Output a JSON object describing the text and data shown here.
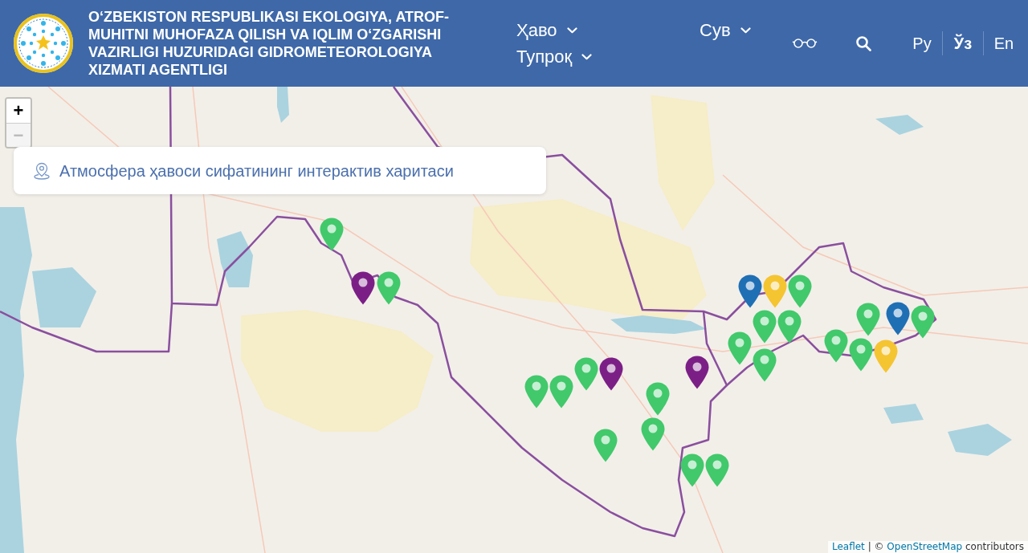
{
  "header": {
    "agency_name": "O‘ZBEKISTON RESPUBLIKASI EKOLOGIYA, ATROF-MUHITNI MUHOFAZA QILISH VA IQLIM O‘ZGARISHI VAZIRLIGI HUZURIDAGI GIDROMETEOROLOGIYA XIZMATI AGENTLIGI"
  },
  "nav": [
    {
      "label": "Ҳаво"
    },
    {
      "label": "Тупроқ"
    },
    {
      "label": "Сув"
    }
  ],
  "languages": [
    {
      "label": "Ру",
      "selected": false
    },
    {
      "label": "Ўз",
      "selected": true
    },
    {
      "label": "En",
      "selected": false
    }
  ],
  "map": {
    "zoom_controls": [
      {
        "label": "+",
        "disabled": false
      },
      {
        "label": "−",
        "disabled": true
      }
    ],
    "title": "Атмосфера ҳавоси сифатининг интерактив харитаси",
    "markers": [
      {
        "color": "#41c96b"
      },
      {
        "color": "#7b1f86"
      },
      {
        "color": "#41c96b"
      },
      {
        "color": "#41c96b"
      },
      {
        "color": "#41c96b"
      },
      {
        "color": "#41c96b"
      },
      {
        "color": "#7b1f86"
      },
      {
        "color": "#7b1f86"
      },
      {
        "color": "#41c96b"
      },
      {
        "color": "#41c96b"
      },
      {
        "color": "#41c96b"
      },
      {
        "color": "#41c96b"
      },
      {
        "color": "#41c96b"
      },
      {
        "color": "#1f6fb5"
      },
      {
        "color": "#f5c431"
      },
      {
        "color": "#41c96b"
      },
      {
        "color": "#41c96b"
      },
      {
        "color": "#41c96b"
      },
      {
        "color": "#41c96b"
      },
      {
        "color": "#41c96b"
      },
      {
        "color": "#41c96b"
      },
      {
        "color": "#41c96b"
      },
      {
        "color": "#41c96b"
      },
      {
        "color": "#f5c431"
      },
      {
        "color": "#1f6fb5"
      },
      {
        "color": "#41c96b"
      }
    ],
    "attribution": [
      {
        "kind": "link",
        "text": "Leaflet"
      },
      {
        "kind": "text",
        "text": "| ©"
      },
      {
        "kind": "link",
        "text": "OpenStreetMap"
      },
      {
        "kind": "text",
        "text": "contributors"
      }
    ]
  }
}
